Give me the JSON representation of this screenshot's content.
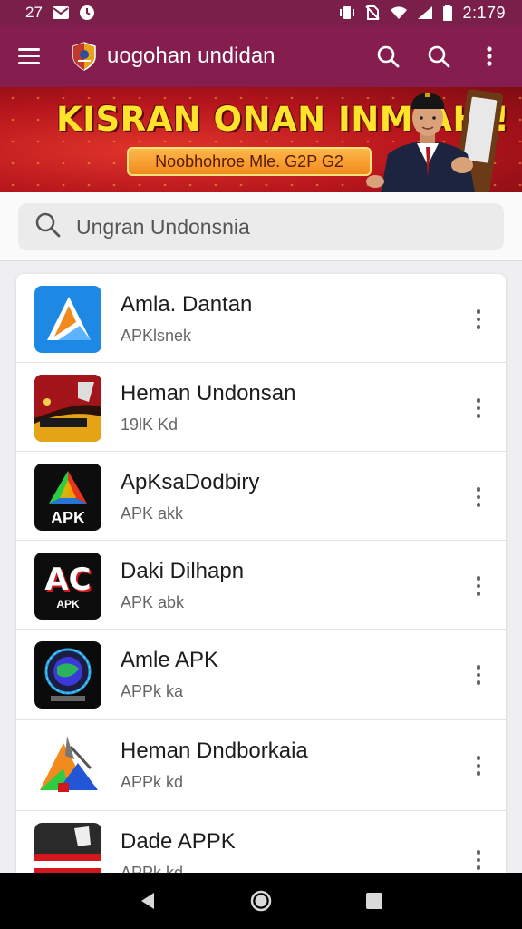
{
  "status_bar": {
    "left_text": "27",
    "time": "2:179",
    "icons": [
      "mail-icon",
      "clock-icon",
      "vibrate-icon",
      "no-sim-icon",
      "wifi-icon",
      "signal-icon",
      "battery-icon"
    ]
  },
  "app_bar": {
    "title": "uogohan undidan",
    "icons": [
      "menu-icon",
      "app-logo",
      "search-icon",
      "search-icon",
      "more-vert-icon"
    ]
  },
  "banner": {
    "headline": "KISRAN ONAN INMIAHI!",
    "subtitle": "Noobhohroe Mle. G2P G2"
  },
  "search": {
    "placeholder": "Ungran Undonsnia"
  },
  "apps": [
    {
      "name": "Amla. Dantan",
      "meta": "APKlsnek",
      "icon": "blue-triangle-app-icon"
    },
    {
      "name": "Heman Undonsan",
      "meta": "19lK  Kd",
      "icon": "red-gold-app-icon"
    },
    {
      "name": "ApKsaDodbiry",
      "meta": "APK akk",
      "icon": "apk-prism-app-icon"
    },
    {
      "name": "Daki Dilhapn",
      "meta": "APK abk",
      "icon": "ac-logo-app-icon"
    },
    {
      "name": "Amle APK",
      "meta": "APPk ka",
      "icon": "globe-app-icon"
    },
    {
      "name": "Heman Dndborkaia",
      "meta": "APPk kd",
      "icon": "triangle-tools-app-icon"
    },
    {
      "name": "Dade APPK",
      "meta": "APPk kd",
      "icon": "flag-app-icon"
    }
  ],
  "apk_icon_label": "APK",
  "ac_icon_label": "AC",
  "ac_icon_sub": "APK",
  "nav_bar": {
    "icons": [
      "back-icon",
      "home-icon",
      "recents-icon"
    ]
  },
  "colors": {
    "primary": "#851e4f",
    "status_bar": "#7a1f4a",
    "banner_red": "#c4161c",
    "banner_yellow": "#ffe22a",
    "banner_cta": "#f59a2a"
  }
}
